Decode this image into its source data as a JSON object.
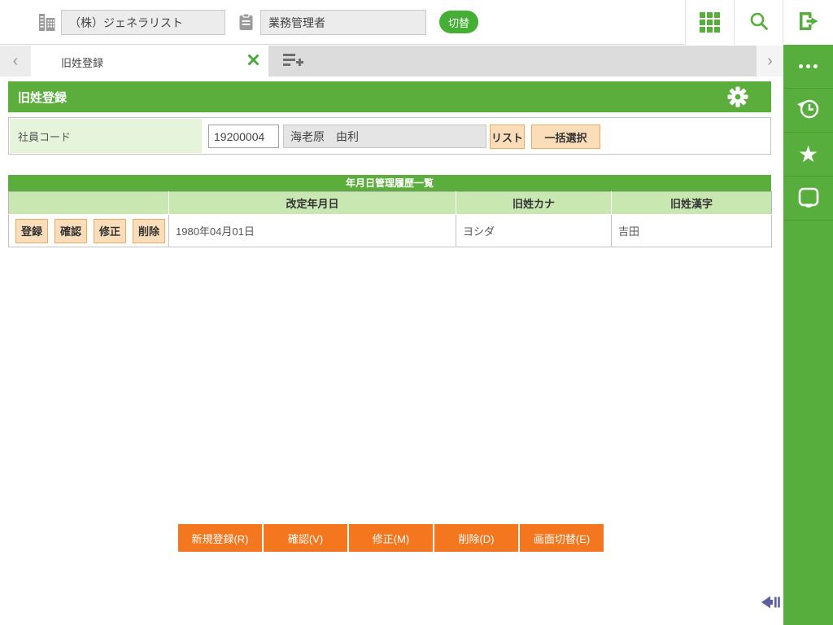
{
  "topbar": {
    "company_value": "（株）ジェネラリスト",
    "role_value": "業務管理者",
    "switch_label": "切替",
    "icons": [
      "building-icon",
      "clipboard-icon",
      "apps-grid-icon",
      "search-icon",
      "logout-icon"
    ]
  },
  "tabbar": {
    "active_tab_label": "旧姓登録",
    "prev_glyph": "‹",
    "next_glyph": "›"
  },
  "sidebar": {
    "items": [
      {
        "icon": "more-ellipsis-icon"
      },
      {
        "icon": "history-clock-icon"
      },
      {
        "icon": "favorite-star-icon",
        "glyph": "★"
      },
      {
        "icon": "memo-note-icon"
      }
    ]
  },
  "page": {
    "title": "旧姓登録"
  },
  "form": {
    "employee_code_label": "社員コード",
    "employee_code_value": "19200004",
    "employee_name_value": "海老原　由利",
    "list_button": "リスト",
    "bulk_select_button": "一括選択"
  },
  "history_table": {
    "title": "年月日管理履歴一覧",
    "columns": [
      "",
      "改定年月日",
      "旧姓カナ",
      "旧姓漢字"
    ],
    "row_actions": [
      "登録",
      "確認",
      "修正",
      "削除"
    ],
    "rows": [
      {
        "date": "1980年04月01日",
        "kana": "ヨシダ",
        "kanji": "吉田"
      }
    ]
  },
  "footer_buttons": [
    "新規登録(R)",
    "確認(V)",
    "修正(M)",
    "削除(D)",
    "画面切替(E)"
  ],
  "colors": {
    "accent_green": "#5bae3c",
    "sidebar_green": "#58ae3d",
    "switch_green": "#45af35",
    "table_header_green": "#c9e7b1",
    "label_green": "#e7f4dc",
    "footer_orange": "#f4771f",
    "peach_button": "#fbdeb9",
    "peach_border": "#f0a960",
    "collapse_arrow": "#5d5f9f"
  }
}
